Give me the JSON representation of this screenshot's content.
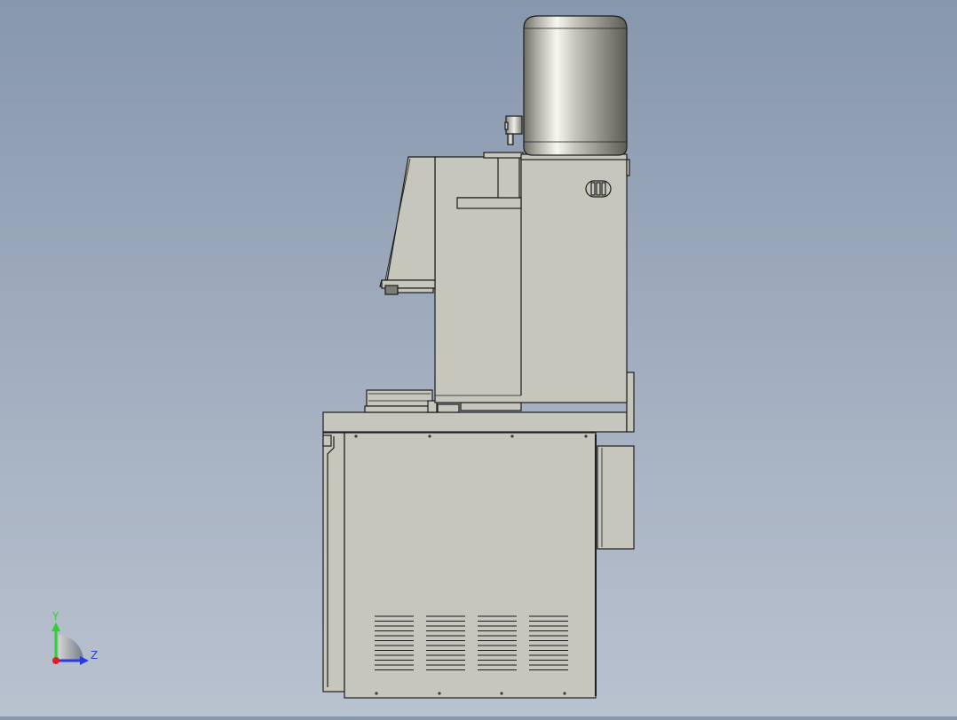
{
  "viewport": {
    "background_top": "#8797ad",
    "background_bottom": "#b9c2cf",
    "part_fill": "#c6c6bc",
    "part_edge": "#1c1c1c"
  },
  "triad": {
    "y_label": "Y",
    "z_label": "Z",
    "y_color": "#2fd12f",
    "z_color": "#2a3cd6",
    "origin_color": "#e02020"
  }
}
